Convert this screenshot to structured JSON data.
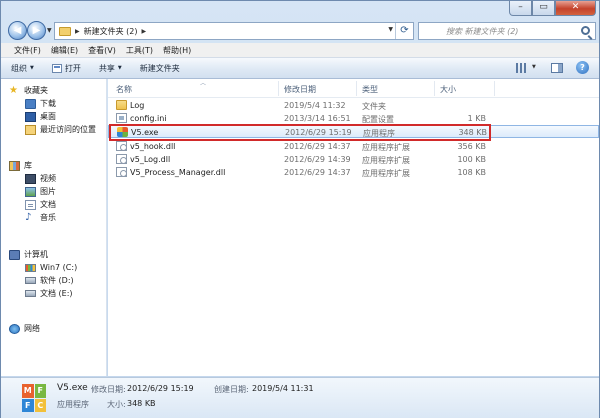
{
  "window": {
    "breadcrumb": "新建文件夹 (2)",
    "search_placeholder": "搜索 新建文件夹 (2)",
    "min": "–",
    "max": "▭",
    "close": "✕"
  },
  "menu": [
    "文件(F)",
    "编辑(E)",
    "查看(V)",
    "工具(T)",
    "帮助(H)"
  ],
  "toolbar": {
    "organize": "组织",
    "open": "打开",
    "share": "共享",
    "new_folder": "新建文件夹",
    "help": "?"
  },
  "nav": {
    "favorites": {
      "label": "收藏夹",
      "items": [
        "下载",
        "桌面",
        "最近访问的位置"
      ]
    },
    "libraries": {
      "label": "库",
      "items": [
        "视频",
        "图片",
        "文档",
        "音乐"
      ]
    },
    "computer": {
      "label": "计算机",
      "items": [
        "Win7 (C:)",
        "软件 (D:)",
        "文档 (E:)"
      ]
    },
    "network": {
      "label": "网络"
    }
  },
  "columns": {
    "name": "名称",
    "date": "修改日期",
    "type": "类型",
    "size": "大小"
  },
  "files": [
    {
      "name": "Log",
      "date": "2019/5/4 11:32",
      "type": "文件夹",
      "size": "",
      "icon": "folder-icon"
    },
    {
      "name": "config.ini",
      "date": "2013/3/14 16:51",
      "type": "配置设置",
      "size": "1 KB",
      "icon": "ini-file-icon"
    },
    {
      "name": "V5.exe",
      "date": "2012/6/29 15:19",
      "type": "应用程序",
      "size": "348 KB",
      "icon": "exe-file-icon"
    },
    {
      "name": "v5_hook.dll",
      "date": "2012/6/29 14:37",
      "type": "应用程序扩展",
      "size": "356 KB",
      "icon": "dll-file-icon"
    },
    {
      "name": "v5_Log.dll",
      "date": "2012/6/29 14:39",
      "type": "应用程序扩展",
      "size": "100 KB",
      "icon": "dll-file-icon"
    },
    {
      "name": "V5_Process_Manager.dll",
      "date": "2012/6/29 14:37",
      "type": "应用程序扩展",
      "size": "108 KB",
      "icon": "dll-file-icon"
    }
  ],
  "details": {
    "icon_letters": [
      "M",
      "F",
      "F",
      "C"
    ],
    "name": "V5.exe",
    "modified_label": "修改日期:",
    "modified": "2012/6/29 15:19",
    "created_label": "创建日期:",
    "created": "2019/5/4 11:31",
    "type": "应用程序",
    "size_label": "大小:",
    "size": "348 KB"
  },
  "colors": {
    "highlight_border": "#d12a2a",
    "selection_bg": "#dcebfb"
  }
}
